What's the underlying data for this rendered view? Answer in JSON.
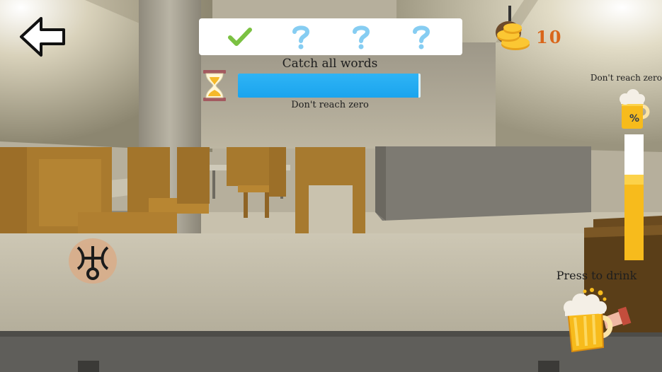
{
  "hud": {
    "objective": "Catch all words",
    "timer_hint": "Don't reach zero",
    "timer_level": 0.99,
    "coins": "10",
    "drink_hint": "Don't reach zero",
    "drink_level": 0.68,
    "drink_prompt": "Press to drink"
  },
  "word_slots": [
    {
      "state": "found",
      "icon": "check-icon"
    },
    {
      "state": "unknown",
      "icon": "question-icon"
    },
    {
      "state": "unknown",
      "icon": "question-icon"
    },
    {
      "state": "unknown",
      "icon": "question-icon"
    }
  ],
  "colors": {
    "timer_fill": "#1aa4ee",
    "drink_fill": "#f7bb1c",
    "coin_text": "#d9661a",
    "check": "#7bc142",
    "question": "#86cdf2"
  },
  "icons": {
    "back": "back-arrow-icon",
    "timer": "hourglass-icon",
    "coins": "coin-stack-icon",
    "drink_meter": "beer-mug-percent-icon",
    "symbol": "uranus-symbol-icon",
    "drink_button": "beer-cheers-icon"
  }
}
